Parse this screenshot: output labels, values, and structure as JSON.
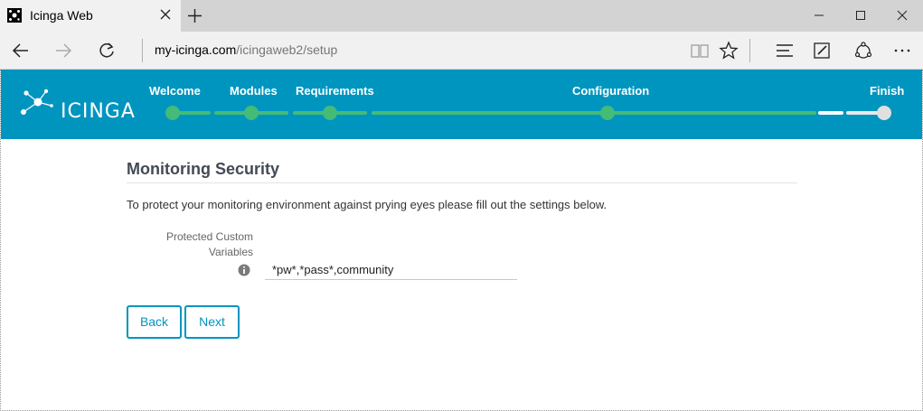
{
  "browser": {
    "tab_title": "Icinga Web",
    "url_host": "my-icinga.com",
    "url_path": "/icingaweb2/setup"
  },
  "app": {
    "logo_text": "ICINGA",
    "steps": [
      "Welcome",
      "Modules",
      "Requirements",
      "Configuration",
      "Finish"
    ]
  },
  "form": {
    "title": "Monitoring Security",
    "description": "To protect your monitoring environment against prying eyes please fill out the settings below.",
    "field_label_line1": "Protected Custom",
    "field_label_line2": "Variables",
    "field_value": "*pw*,*pass*,community",
    "back_label": "Back",
    "next_label": "Next"
  },
  "colors": {
    "header": "#0095bf",
    "progress": "#44bb77",
    "accent": "#0095bf"
  }
}
